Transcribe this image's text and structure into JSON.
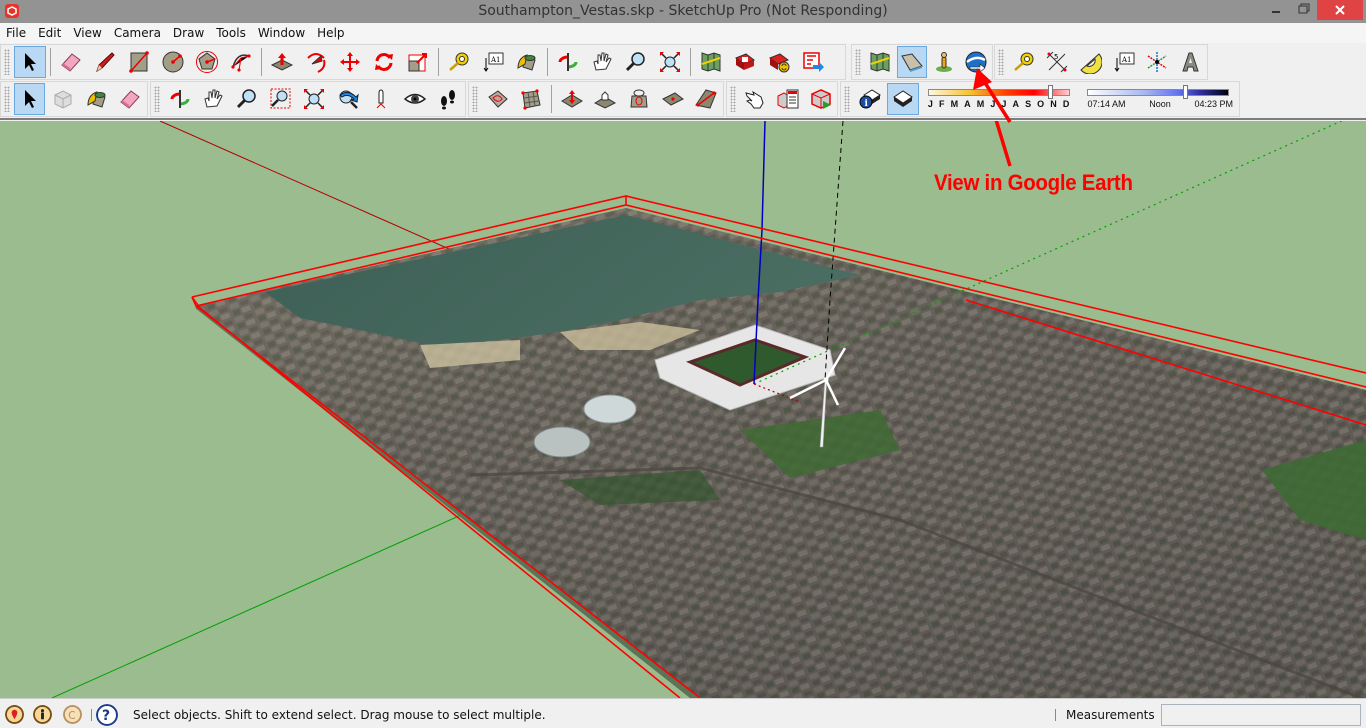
{
  "window": {
    "title": "Southampton_Vestas.skp - SketchUp Pro (Not Responding)",
    "app_icon": "sketchup-logo-icon",
    "controls": [
      "minimize",
      "maximize",
      "close"
    ]
  },
  "menubar": {
    "items": [
      "File",
      "Edit",
      "View",
      "Camera",
      "Draw",
      "Tools",
      "Window",
      "Help"
    ]
  },
  "toolbars": {
    "row1": {
      "main": [
        "select",
        "eraser",
        "pencil",
        "rectangle",
        "circle",
        "polygon",
        "arc",
        "push-pull",
        "follow-me",
        "move",
        "rotate",
        "scale",
        "tape-measure",
        "text",
        "paint-bucket",
        "orbit",
        "pan",
        "zoom",
        "zoom-extents",
        "add-location",
        "3d-warehouse",
        "share-component",
        "extension-warehouse"
      ],
      "google": [
        "add-location",
        "toggle-terrain",
        "photo-textures",
        "view-in-google-earth"
      ],
      "construction": [
        "tape-measure",
        "dimensions",
        "protractor",
        "text",
        "axes",
        "3d-text"
      ]
    },
    "row2": {
      "principal": [
        "select",
        "make-component",
        "paint-bucket",
        "eraser"
      ],
      "camera": [
        "orbit",
        "pan",
        "zoom",
        "zoom-window",
        "zoom-extents",
        "previous",
        "position-camera",
        "look-around",
        "walk"
      ],
      "sandbox": [
        "from-contours",
        "from-scratch",
        "smoove",
        "stamp",
        "drape",
        "add-detail",
        "flip-edge"
      ],
      "warehouse": [
        "interact",
        "component-options",
        "component-attributes"
      ],
      "shadows": [
        "shadow-settings",
        "display-shadows"
      ]
    },
    "shadows": {
      "months": [
        "J",
        "F",
        "M",
        "A",
        "M",
        "J",
        "J",
        "A",
        "S",
        "O",
        "N",
        "D"
      ],
      "month_position": 0.86,
      "time_start": "07:14 AM",
      "time_mid": "Noon",
      "time_end": "04:23 PM",
      "time_position": 0.68
    }
  },
  "viewport": {
    "annotation": "View in Google Earth",
    "annotation_color": "#ff0000",
    "ground_color": "#9abc8f",
    "axis_colors": {
      "red": "#c00000",
      "green": "#00a000",
      "blue": "#0000c0"
    },
    "selection_color": "#ff0000"
  },
  "statusbar": {
    "icons": [
      "geo-location-icon",
      "credits-icon",
      "copyright-icon",
      "help-icon"
    ],
    "message": "Select objects. Shift to extend select. Drag mouse to select multiple.",
    "measurements_label": "Measurements",
    "measurements_value": ""
  }
}
